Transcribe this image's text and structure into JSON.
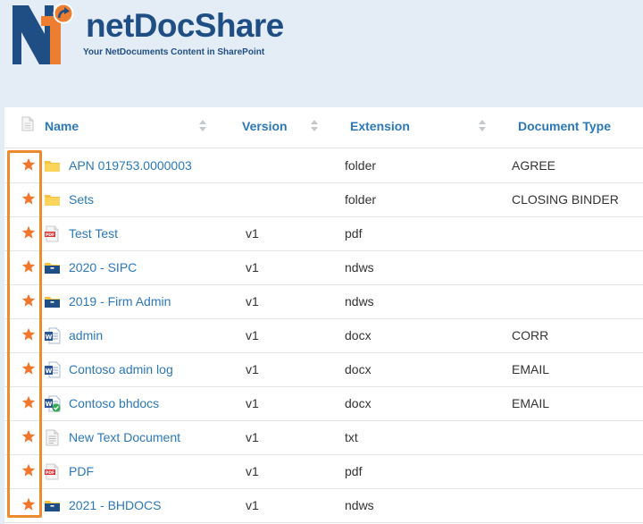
{
  "logo": {
    "title": "netDocShare",
    "tagline": "Your NetDocuments Content in SharePoint"
  },
  "table": {
    "columns": [
      "Name",
      "Version",
      "Extension",
      "Document Type"
    ],
    "rows": [
      {
        "name": "APN 019753.0000003",
        "version": "",
        "extension": "folder",
        "document_type": "AGREE",
        "icon": "folder-icon"
      },
      {
        "name": "Sets",
        "version": "",
        "extension": "folder",
        "document_type": "CLOSING BINDER",
        "icon": "folder-icon"
      },
      {
        "name": "Test Test",
        "version": "v1",
        "extension": "pdf",
        "document_type": "",
        "icon": "pdf-icon"
      },
      {
        "name": "2020 - SIPC",
        "version": "v1",
        "extension": "ndws",
        "document_type": "",
        "icon": "workspace-icon"
      },
      {
        "name": "2019 - Firm Admin",
        "version": "v1",
        "extension": "ndws",
        "document_type": "",
        "icon": "workspace-icon"
      },
      {
        "name": "admin",
        "version": "v1",
        "extension": "docx",
        "document_type": "CORR",
        "icon": "word-icon"
      },
      {
        "name": "Contoso admin log",
        "version": "v1",
        "extension": "docx",
        "document_type": "EMAIL",
        "icon": "word-icon"
      },
      {
        "name": "Contoso bhdocs",
        "version": "v1",
        "extension": "docx",
        "document_type": "EMAIL",
        "icon": "word-checked-icon"
      },
      {
        "name": "New Text Document",
        "version": "v1",
        "extension": "txt",
        "document_type": "",
        "icon": "text-file-icon"
      },
      {
        "name": "PDF",
        "version": "v1",
        "extension": "pdf",
        "document_type": "",
        "icon": "pdf-icon"
      },
      {
        "name": "2021 - BHDOCS",
        "version": "v1",
        "extension": "ndws",
        "document_type": "",
        "icon": "workspace-icon"
      }
    ]
  },
  "colors": {
    "brand_blue": "#1f4e84",
    "link_blue": "#2b78b9",
    "accent_orange": "#ed8a2e",
    "star_orange": "#f0772b",
    "page_background": "#e4ecf5"
  }
}
